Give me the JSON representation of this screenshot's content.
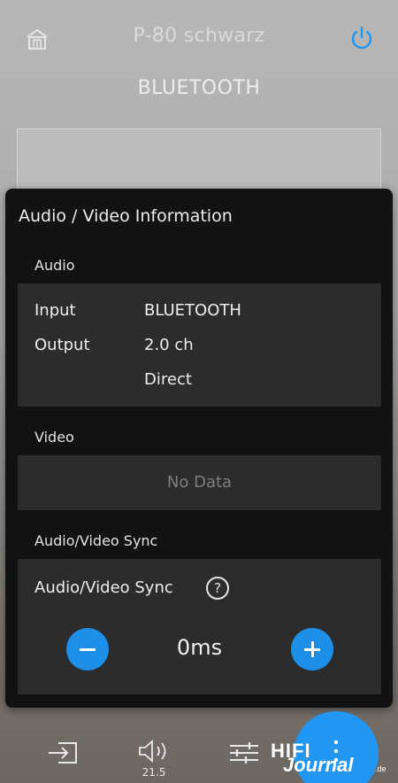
{
  "header": {
    "device_name": "P-80 schwarz",
    "source": "BLUETOOTH"
  },
  "modal": {
    "title": "Audio / Video Information",
    "audio": {
      "section_label": "Audio",
      "rows": [
        {
          "key": "Input",
          "value": "BLUETOOTH"
        },
        {
          "key": "Output",
          "value": "2.0 ch"
        },
        {
          "key": "",
          "value": "Direct"
        }
      ]
    },
    "video": {
      "section_label": "Video",
      "empty_text": "No Data"
    },
    "sync": {
      "section_label": "Audio/Video Sync",
      "label": "Audio/Video Sync",
      "help_glyph": "?",
      "value": "0ms"
    }
  },
  "bottom_bar": {
    "volume_value": "21.5"
  },
  "watermark": {
    "line1": "HIFI",
    "line2": "Journal",
    "suffix": ".de"
  },
  "icons": [
    "home-icon",
    "power-icon",
    "help-icon",
    "minus-icon",
    "plus-icon",
    "input-icon",
    "volume-icon",
    "equalizer-icon",
    "more-vertical-icon"
  ],
  "colors": {
    "accent": "#2196f3",
    "modal_bg": "#121212",
    "card_bg": "#2c2c2c"
  }
}
